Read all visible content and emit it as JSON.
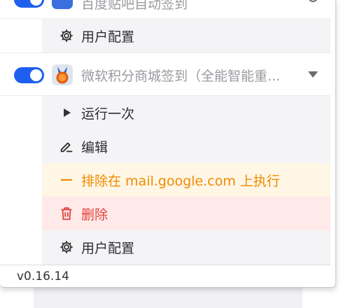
{
  "scripts": [
    {
      "name": "百度贴吧自动签到",
      "enabled": true,
      "menu": [
        {
          "icon": "gear-icon",
          "label": "用户配置"
        }
      ]
    },
    {
      "name": "微软积分商城签到（全能智能重...",
      "enabled": true,
      "icon": "medal-icon",
      "menu": [
        {
          "icon": "play-icon",
          "label": "运行一次"
        },
        {
          "icon": "edit-icon",
          "label": "编辑"
        },
        {
          "icon": "minus-icon",
          "label": "排除在 mail.google.com 上执行"
        },
        {
          "icon": "trash-icon",
          "label": "删除"
        },
        {
          "icon": "gear-icon",
          "label": "用户配置"
        }
      ]
    }
  ],
  "footer": {
    "version": "v0.16.14"
  },
  "colors": {
    "accent": "#1f5ff0",
    "warn": "#f08a00",
    "danger": "#e0423a"
  }
}
